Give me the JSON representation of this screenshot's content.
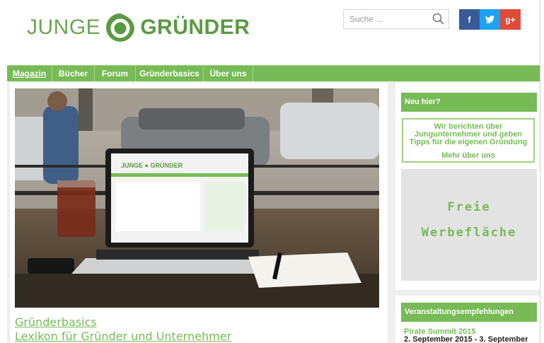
{
  "brand": {
    "left": "JUNGE",
    "right": "GRÜNDER",
    "color": "#6aa84f"
  },
  "search": {
    "placeholder": "Suche ...",
    "icon": "search-icon"
  },
  "social": {
    "facebook": "f",
    "twitter": "t",
    "googleplus": "g+"
  },
  "nav": {
    "items": [
      "Magazin",
      "Bücher",
      "Forum",
      "Gründerbasics",
      "Über uns"
    ],
    "active": "Magazin"
  },
  "article": {
    "category": "Gründerbasics",
    "title": "Lexikon für Gründer und Unternehmer"
  },
  "sidebar": {
    "neu_hier": {
      "heading": "Neu hier?",
      "text_lines": [
        "Wir berichten über",
        "Jungunternehmer und geben",
        "Tipps für die eigenen Gründung"
      ],
      "link": "Mehr über uns"
    },
    "ad": {
      "line1": "Freie",
      "line2": "Werbefläche"
    },
    "events": {
      "heading": "Veranstaltungsempfehlungen",
      "first_name": "Pirate Summit 2015",
      "first_date": "2. September 2015 - 3. September"
    }
  },
  "colors": {
    "accent": "#76bb55",
    "background": "#eeeeee"
  }
}
